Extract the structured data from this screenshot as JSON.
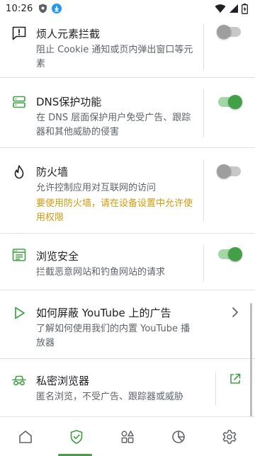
{
  "status_bar": {
    "time": "10:26",
    "icons": [
      "shield-icon",
      "download-icon",
      "wifi-icon",
      "signal-icon",
      "battery-icon"
    ]
  },
  "items": [
    {
      "title": "烦人元素拦截",
      "description": "阻止 Cookie 通知或页内弹出窗口等元素",
      "icon": "annoyance-icon",
      "control": "toggle",
      "enabled": false
    },
    {
      "title": "DNS保护功能",
      "description": "在 DNS 层面保护用户免受广告、跟踪器和其他威胁的侵害",
      "icon": "dns-icon",
      "control": "toggle",
      "enabled": true
    },
    {
      "title": "防火墙",
      "description": "允许控制应用对互联网的访问",
      "warning": "要使用防火墙，请在设备设置中允许使用权限",
      "icon": "firewall-icon",
      "control": "toggle",
      "enabled": false
    },
    {
      "title": "浏览安全",
      "description": "拦截恶意网站和钓鱼网站的请求",
      "icon": "browsing-security-icon",
      "control": "toggle",
      "enabled": true
    },
    {
      "title": "如何屏蔽 YouTube 上的广告",
      "description": "了解如何使用我们的内置 YouTube 播放器",
      "icon": "play-icon",
      "control": "chevron-right-icon"
    },
    {
      "title": "私密浏览器",
      "description": "匿名浏览，不受广告、跟踪器或威胁",
      "icon": "incognito-icon",
      "control": "external-link-icon"
    }
  ],
  "bottom_nav": {
    "items": [
      "home-icon",
      "protection-icon",
      "apps-icon",
      "statistics-icon",
      "settings-icon"
    ],
    "selected": "protection-icon"
  },
  "colors": {
    "accent": "#43a047",
    "toggle_on_track": "#a5d6a7",
    "toggle_off_thumb": "#9e9e9e",
    "warning": "#d39a0f",
    "divider": "#e0e0e0"
  }
}
